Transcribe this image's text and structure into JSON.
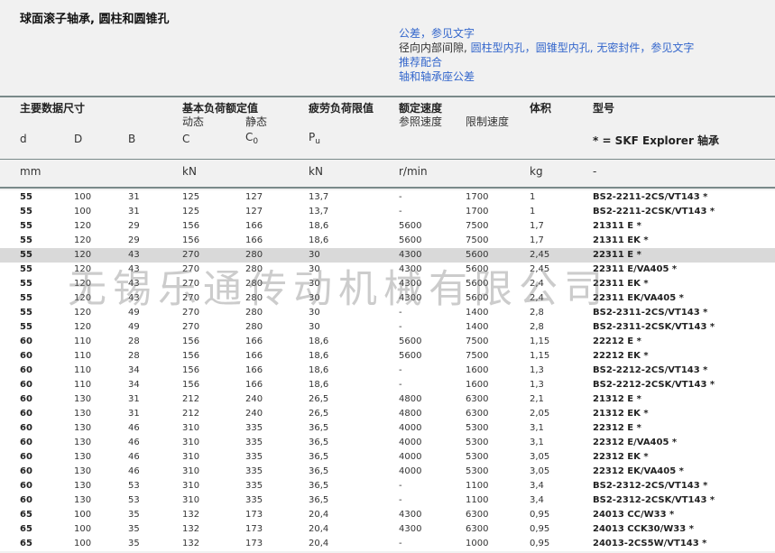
{
  "title": "球面滚子轴承, 圆柱和圆锥孔",
  "links": {
    "row1": {
      "a": "公差",
      "sep": "，",
      "b": "参见文字"
    },
    "row2": {
      "prefix": "径向内部间隙,",
      "a": "圆柱型内孔",
      "sep1": "，",
      "b": "圆锥型内孔,",
      "c": "无密封件",
      "sep2": "，",
      "d": "参见文字"
    },
    "row3": "推荐配合",
    "row4": "轴和轴承座公差"
  },
  "header": {
    "main_dims": "主要数据尺寸",
    "basic_load": "基本负荷额定值",
    "dynamic": "动态",
    "static": "静态",
    "fatigue": "疲劳负荷限值",
    "speed": "额定速度",
    "ref_speed": "参照速度",
    "limit_speed": "限制速度",
    "mass": "体积",
    "designation": "型号",
    "sym_d": "d",
    "sym_D": "D",
    "sym_B": "B",
    "sym_C": "C",
    "sym_C0": "C",
    "sym_C0_sub": "0",
    "sym_Pu": "P",
    "sym_Pu_sub": "u",
    "explorer": "* = SKF Explorer 轴承",
    "unit_mm": "mm",
    "unit_kN1": "kN",
    "unit_kN2": "kN",
    "unit_rmin": "r/min",
    "unit_kg": "kg",
    "unit_dash": "-"
  },
  "rows": [
    {
      "d": "55",
      "D": "100",
      "B": "31",
      "C": "125",
      "C0": "127",
      "Pu": "13,7",
      "ref": "-",
      "lim": "1700",
      "kg": "1",
      "model": "BS2-2211-2CS/VT143 *"
    },
    {
      "d": "55",
      "D": "100",
      "B": "31",
      "C": "125",
      "C0": "127",
      "Pu": "13,7",
      "ref": "-",
      "lim": "1700",
      "kg": "1",
      "model": "BS2-2211-2CSK/VT143 *"
    },
    {
      "d": "55",
      "D": "120",
      "B": "29",
      "C": "156",
      "C0": "166",
      "Pu": "18,6",
      "ref": "5600",
      "lim": "7500",
      "kg": "1,7",
      "model": "21311 E *"
    },
    {
      "d": "55",
      "D": "120",
      "B": "29",
      "C": "156",
      "C0": "166",
      "Pu": "18,6",
      "ref": "5600",
      "lim": "7500",
      "kg": "1,7",
      "model": "21311 EK *"
    },
    {
      "d": "55",
      "D": "120",
      "B": "43",
      "C": "270",
      "C0": "280",
      "Pu": "30",
      "ref": "4300",
      "lim": "5600",
      "kg": "2,45",
      "model": "22311 E *"
    },
    {
      "d": "55",
      "D": "120",
      "B": "43",
      "C": "270",
      "C0": "280",
      "Pu": "30",
      "ref": "4300",
      "lim": "5600",
      "kg": "2,45",
      "model": "22311 E/VA405 *"
    },
    {
      "d": "55",
      "D": "120",
      "B": "43",
      "C": "270",
      "C0": "280",
      "Pu": "30",
      "ref": "4300",
      "lim": "5600",
      "kg": "2,4",
      "model": "22311 EK *"
    },
    {
      "d": "55",
      "D": "120",
      "B": "43",
      "C": "270",
      "C0": "280",
      "Pu": "30",
      "ref": "4300",
      "lim": "5600",
      "kg": "2,4",
      "model": "22311 EK/VA405 *"
    },
    {
      "d": "55",
      "D": "120",
      "B": "49",
      "C": "270",
      "C0": "280",
      "Pu": "30",
      "ref": "-",
      "lim": "1400",
      "kg": "2,8",
      "model": "BS2-2311-2CS/VT143 *"
    },
    {
      "d": "55",
      "D": "120",
      "B": "49",
      "C": "270",
      "C0": "280",
      "Pu": "30",
      "ref": "-",
      "lim": "1400",
      "kg": "2,8",
      "model": "BS2-2311-2CSK/VT143 *"
    },
    {
      "d": "60",
      "D": "110",
      "B": "28",
      "C": "156",
      "C0": "166",
      "Pu": "18,6",
      "ref": "5600",
      "lim": "7500",
      "kg": "1,15",
      "model": "22212 E *"
    },
    {
      "d": "60",
      "D": "110",
      "B": "28",
      "C": "156",
      "C0": "166",
      "Pu": "18,6",
      "ref": "5600",
      "lim": "7500",
      "kg": "1,15",
      "model": "22212 EK *"
    },
    {
      "d": "60",
      "D": "110",
      "B": "34",
      "C": "156",
      "C0": "166",
      "Pu": "18,6",
      "ref": "-",
      "lim": "1600",
      "kg": "1,3",
      "model": "BS2-2212-2CS/VT143 *"
    },
    {
      "d": "60",
      "D": "110",
      "B": "34",
      "C": "156",
      "C0": "166",
      "Pu": "18,6",
      "ref": "-",
      "lim": "1600",
      "kg": "1,3",
      "model": "BS2-2212-2CSK/VT143 *"
    },
    {
      "d": "60",
      "D": "130",
      "B": "31",
      "C": "212",
      "C0": "240",
      "Pu": "26,5",
      "ref": "4800",
      "lim": "6300",
      "kg": "2,1",
      "model": "21312 E *"
    },
    {
      "d": "60",
      "D": "130",
      "B": "31",
      "C": "212",
      "C0": "240",
      "Pu": "26,5",
      "ref": "4800",
      "lim": "6300",
      "kg": "2,05",
      "model": "21312 EK *"
    },
    {
      "d": "60",
      "D": "130",
      "B": "46",
      "C": "310",
      "C0": "335",
      "Pu": "36,5",
      "ref": "4000",
      "lim": "5300",
      "kg": "3,1",
      "model": "22312 E *"
    },
    {
      "d": "60",
      "D": "130",
      "B": "46",
      "C": "310",
      "C0": "335",
      "Pu": "36,5",
      "ref": "4000",
      "lim": "5300",
      "kg": "3,1",
      "model": "22312 E/VA405 *"
    },
    {
      "d": "60",
      "D": "130",
      "B": "46",
      "C": "310",
      "C0": "335",
      "Pu": "36,5",
      "ref": "4000",
      "lim": "5300",
      "kg": "3,05",
      "model": "22312 EK *"
    },
    {
      "d": "60",
      "D": "130",
      "B": "46",
      "C": "310",
      "C0": "335",
      "Pu": "36,5",
      "ref": "4000",
      "lim": "5300",
      "kg": "3,05",
      "model": "22312 EK/VA405 *"
    },
    {
      "d": "60",
      "D": "130",
      "B": "53",
      "C": "310",
      "C0": "335",
      "Pu": "36,5",
      "ref": "-",
      "lim": "1100",
      "kg": "3,4",
      "model": "BS2-2312-2CS/VT143 *"
    },
    {
      "d": "60",
      "D": "130",
      "B": "53",
      "C": "310",
      "C0": "335",
      "Pu": "36,5",
      "ref": "-",
      "lim": "1100",
      "kg": "3,4",
      "model": "BS2-2312-2CSK/VT143 *"
    },
    {
      "d": "65",
      "D": "100",
      "B": "35",
      "C": "132",
      "C0": "173",
      "Pu": "20,4",
      "ref": "4300",
      "lim": "6300",
      "kg": "0,95",
      "model": "24013 CC/W33 *"
    },
    {
      "d": "65",
      "D": "100",
      "B": "35",
      "C": "132",
      "C0": "173",
      "Pu": "20,4",
      "ref": "4300",
      "lim": "6300",
      "kg": "0,95",
      "model": "24013 CCK30/W33 *"
    },
    {
      "d": "65",
      "D": "100",
      "B": "35",
      "C": "132",
      "C0": "173",
      "Pu": "20,4",
      "ref": "-",
      "lim": "1000",
      "kg": "0,95",
      "model": "24013-2CS5W/VT143 *"
    }
  ],
  "highlight_row": 4,
  "watermark": "无锡乐通传动机械有限公司"
}
